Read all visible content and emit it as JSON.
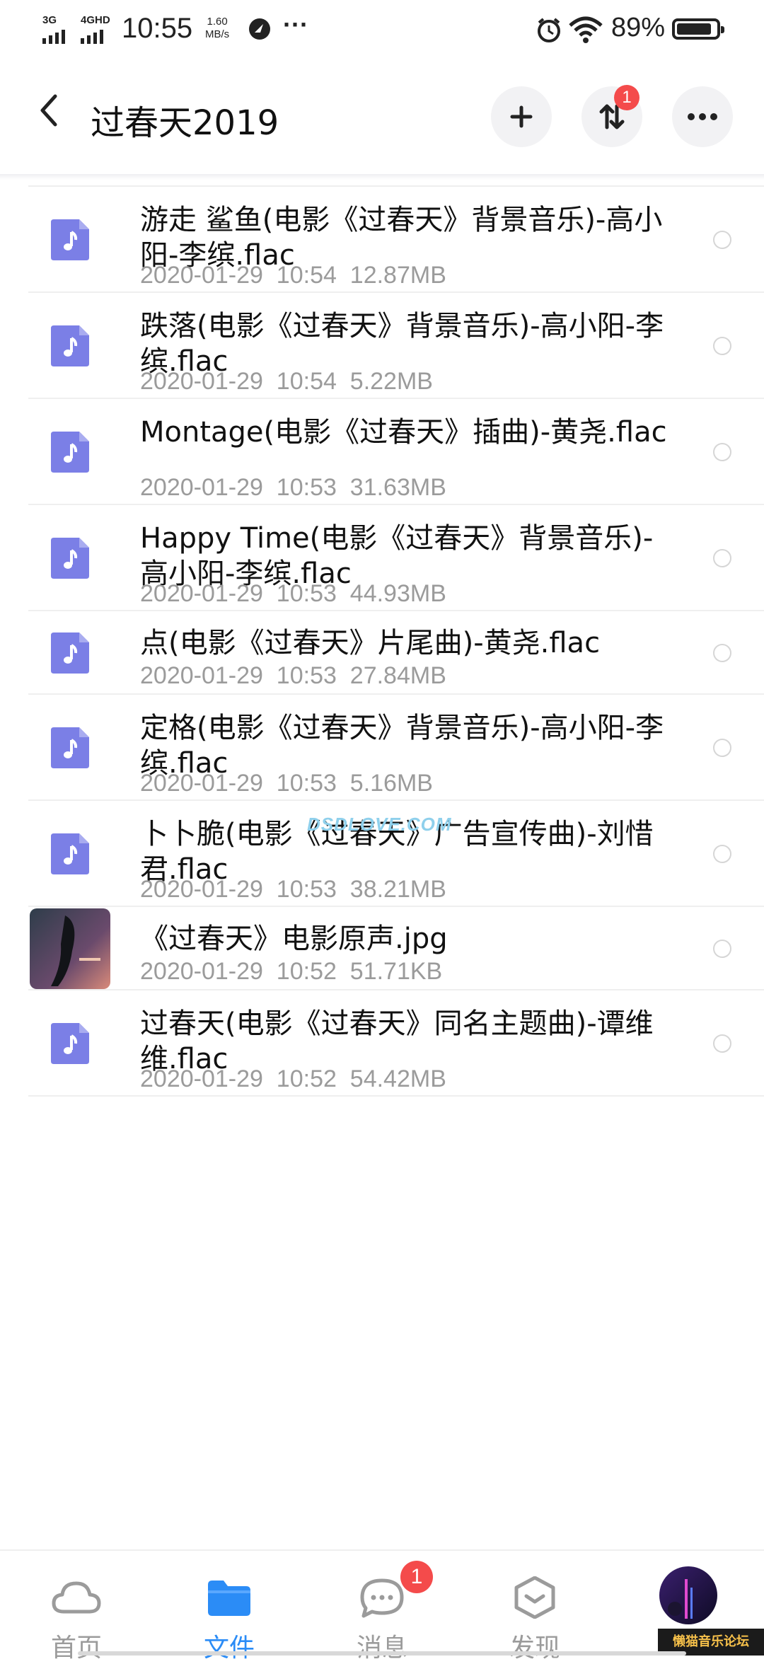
{
  "status_bar": {
    "network_1": "3G",
    "network_2": "4GHD",
    "time": "10:55",
    "speed_value": "1.60",
    "speed_unit": "MB/s",
    "more": "···",
    "battery_pct": "89%",
    "battery_level": 0.89
  },
  "header": {
    "title": "过春天2019",
    "transfer_badge": "1"
  },
  "files": [
    {
      "name": "游走 鲨鱼(电影《过春天》背景音乐)-高小阳-李缤.flac",
      "meta": "2020-01-29  10:54  12.87MB",
      "type": "audio"
    },
    {
      "name": "跌落(电影《过春天》背景音乐)-高小阳-李缤.flac",
      "meta": "2020-01-29  10:54  5.22MB",
      "type": "audio"
    },
    {
      "name": "Montage(电影《过春天》插曲)-黄尧.flac",
      "meta": "2020-01-29  10:53  31.63MB",
      "type": "audio"
    },
    {
      "name": "Happy Time(电影《过春天》背景音乐)-高小阳-李缤.flac",
      "meta": "2020-01-29  10:53  44.93MB",
      "type": "audio"
    },
    {
      "name": "点(电影《过春天》片尾曲)-黄尧.flac",
      "meta": "2020-01-29  10:53  27.84MB",
      "type": "audio"
    },
    {
      "name": "定格(电影《过春天》背景音乐)-高小阳-李缤.flac",
      "meta": "2020-01-29  10:53  5.16MB",
      "type": "audio"
    },
    {
      "name": "卜卜脆(电影《过春天》广告宣传曲)-刘惜君.flac",
      "meta": "2020-01-29  10:53  38.21MB",
      "type": "audio"
    },
    {
      "name": "《过春天》电影原声.jpg",
      "meta": "2020-01-29  10:52  51.71KB",
      "type": "image"
    },
    {
      "name": "过春天(电影《过春天》同名主题曲)-谭维维.flac",
      "meta": "2020-01-29  10:52  54.42MB",
      "type": "audio"
    }
  ],
  "watermark": "DSDLOVE.COM",
  "bottom_nav": [
    {
      "label": "首页",
      "icon": "cloud-icon"
    },
    {
      "label": "文件",
      "icon": "folder-icon"
    },
    {
      "label": "消息",
      "icon": "message-icon",
      "badge": "1"
    },
    {
      "label": "发现",
      "icon": "discover-icon"
    }
  ],
  "corner_logo": "懒猫音乐论坛",
  "colors": {
    "accent": "#2b8cf6",
    "audio_icon": "#7b7fe6",
    "badge": "#f44b4b",
    "meta_text": "#9b9b9b"
  }
}
